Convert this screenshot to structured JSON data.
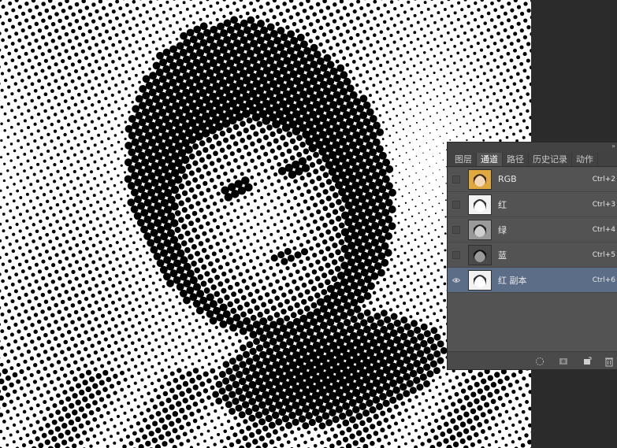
{
  "panel": {
    "collapse_glyph": "»",
    "tabs": [
      {
        "label": "图层",
        "active": false
      },
      {
        "label": "通道",
        "active": true
      },
      {
        "label": "路径",
        "active": false
      },
      {
        "label": "历史记录",
        "active": false
      },
      {
        "label": "动作",
        "active": false
      }
    ],
    "channels": [
      {
        "name": "RGB",
        "shortcut": "Ctrl+2",
        "visible": false,
        "selected": false,
        "thumb": "color-portrait"
      },
      {
        "name": "红",
        "shortcut": "Ctrl+3",
        "visible": false,
        "selected": false,
        "thumb": "light-portrait"
      },
      {
        "name": "绿",
        "shortcut": "Ctrl+4",
        "visible": false,
        "selected": false,
        "thumb": "gray-portrait"
      },
      {
        "name": "蓝",
        "shortcut": "Ctrl+5",
        "visible": false,
        "selected": false,
        "thumb": "dark-portrait"
      },
      {
        "name": "红 副本",
        "shortcut": "Ctrl+6",
        "visible": true,
        "selected": true,
        "thumb": "light-portrait"
      }
    ],
    "bottom_icons": [
      "load-selection-icon",
      "save-selection-icon",
      "new-channel-icon",
      "delete-channel-icon"
    ],
    "colors": {
      "selected_row": "#5b6d87",
      "panel_bg": "#535353",
      "rgb_thumb": "#e0a93f"
    }
  }
}
